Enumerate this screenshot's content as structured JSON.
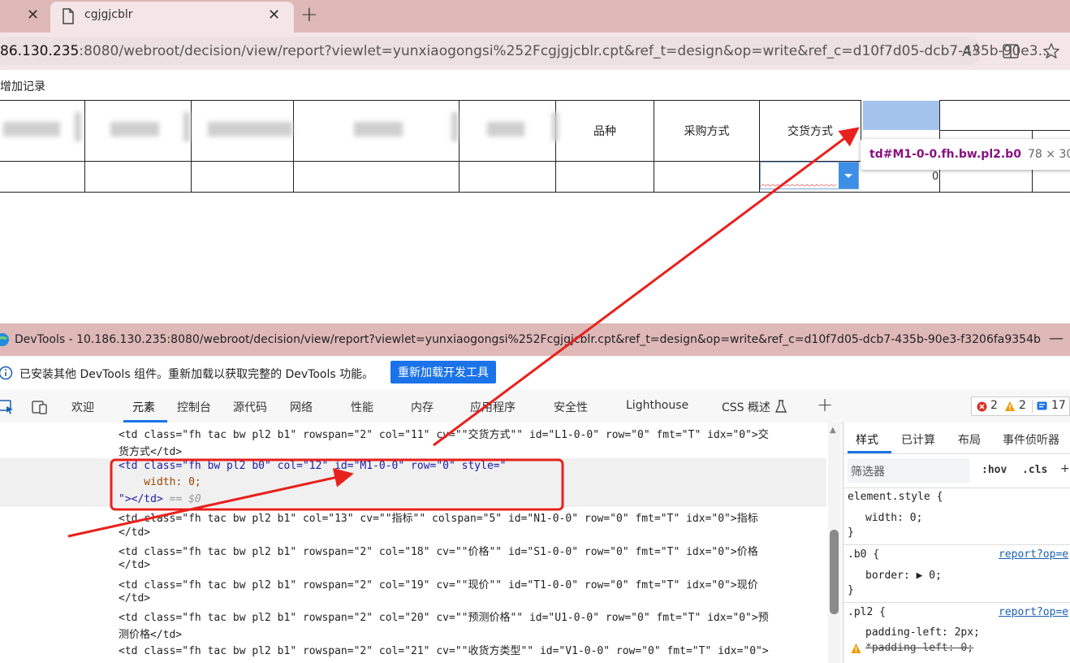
{
  "browser": {
    "tab_title": "cgjgjcblr",
    "url_host": "86.130.235",
    "url_rest": ":8080/webroot/decision/view/report?viewlet=yunxiaogongsi%252Fcgjgjcblr.cpt&ref_t=design&op=write&ref_c=d10f7d05-dcb7-435b-90e3...",
    "close_glyph": "✕",
    "new_tab_glyph": "+"
  },
  "report": {
    "add_record_label": "增加记录",
    "headers": [
      "品种",
      "采购方式",
      "交货方式"
    ],
    "row_value": "0"
  },
  "inspect_tooltip": {
    "selector": "td#M1-0-0.fh.bw.pl2.b0",
    "size": "78 × 30"
  },
  "devtools": {
    "title": "DevTools - 10.186.130.235:8080/webroot/decision/view/report?viewlet=yunxiaogongsi%252Fcgjgjcblr.cpt&ref_t=design&op=write&ref_c=d10f7d05-dcb7-435b-90e3-f3206fa9354b",
    "info_text": "已安装其他 DevTools 组件。重新加载以获取完整的 DevTools 功能。",
    "reload_button": "重新加载开发工具",
    "tabs": [
      "欢迎",
      "元素",
      "控制台",
      "源代码",
      "网络",
      "性能",
      "内存",
      "应用程序",
      "安全性",
      "Lighthouse",
      "CSS 概述"
    ],
    "error_count": "2",
    "warning_count": "2",
    "info_count": "17",
    "styles_tabs": [
      "样式",
      "已计算",
      "布局",
      "事件侦听器"
    ],
    "filter_placeholder": "筛选器",
    "hov": ":hov",
    "cls": ".cls",
    "dom_lines": [
      "<td class=\"fh tac bw pl2 b1\" rowspan=\"2\" col=\"11\" cv=\"\"交货方式\"\" id=\"L1-0-0\" row=\"0\" fmt=\"T\" idx=\"0\">交",
      "货方式</td>",
      "<td class=\"fh bw pl2 b0\" col=\"12\" id=\"M1-0-0\" row=\"0\" style=\"",
      "    width: 0;",
      "\"></td>",
      "<td class=\"fh tac bw pl2 b1\" col=\"13\" cv=\"\"指标\"\" colspan=\"5\" id=\"N1-0-0\" row=\"0\" fmt=\"T\" idx=\"0\">指标",
      "</td>",
      "<td class=\"fh tac bw pl2 b1\" rowspan=\"2\" col=\"18\" cv=\"\"价格\"\" id=\"S1-0-0\" row=\"0\" fmt=\"T\" idx=\"0\">价格",
      "</td>",
      "<td class=\"fh tac bw pl2 b1\" rowspan=\"2\" col=\"19\" cv=\"\"现价\"\" id=\"T1-0-0\" row=\"0\" fmt=\"T\" idx=\"0\">现价",
      "</td>",
      "<td class=\"fh tac bw pl2 b1\" rowspan=\"2\" col=\"20\" cv=\"\"预测价格\"\" id=\"U1-0-0\" row=\"0\" fmt=\"T\" idx=\"0\">预",
      "测价格</td>",
      "<td class=\"fh tac bw pl2 b1\" rowspan=\"2\" col=\"21\" cv=\"\"收货方类型\"\" id=\"V1-0-0\" row=\"0\" fmt=\"T\" idx=\"0\">"
    ],
    "selected_suffix": " == $0",
    "styles": {
      "element_style": "element.style {",
      "width_decl": "width: 0;",
      "close_brace": "}",
      "b0_rule": ".b0 {",
      "border_decl": "border: ▶ 0;",
      "pl2_rule": ".pl2 {",
      "padding_decl": "padding-left: 2px;",
      "padding_struck": "*padding-left: 0;",
      "source_link": "report?op=e"
    }
  },
  "colors": {
    "tab_strip": "#dfb8b8",
    "highlight_box": "#a4c3ec",
    "annotation_red": "#e8211c",
    "reload_button": "#1a73e8"
  }
}
